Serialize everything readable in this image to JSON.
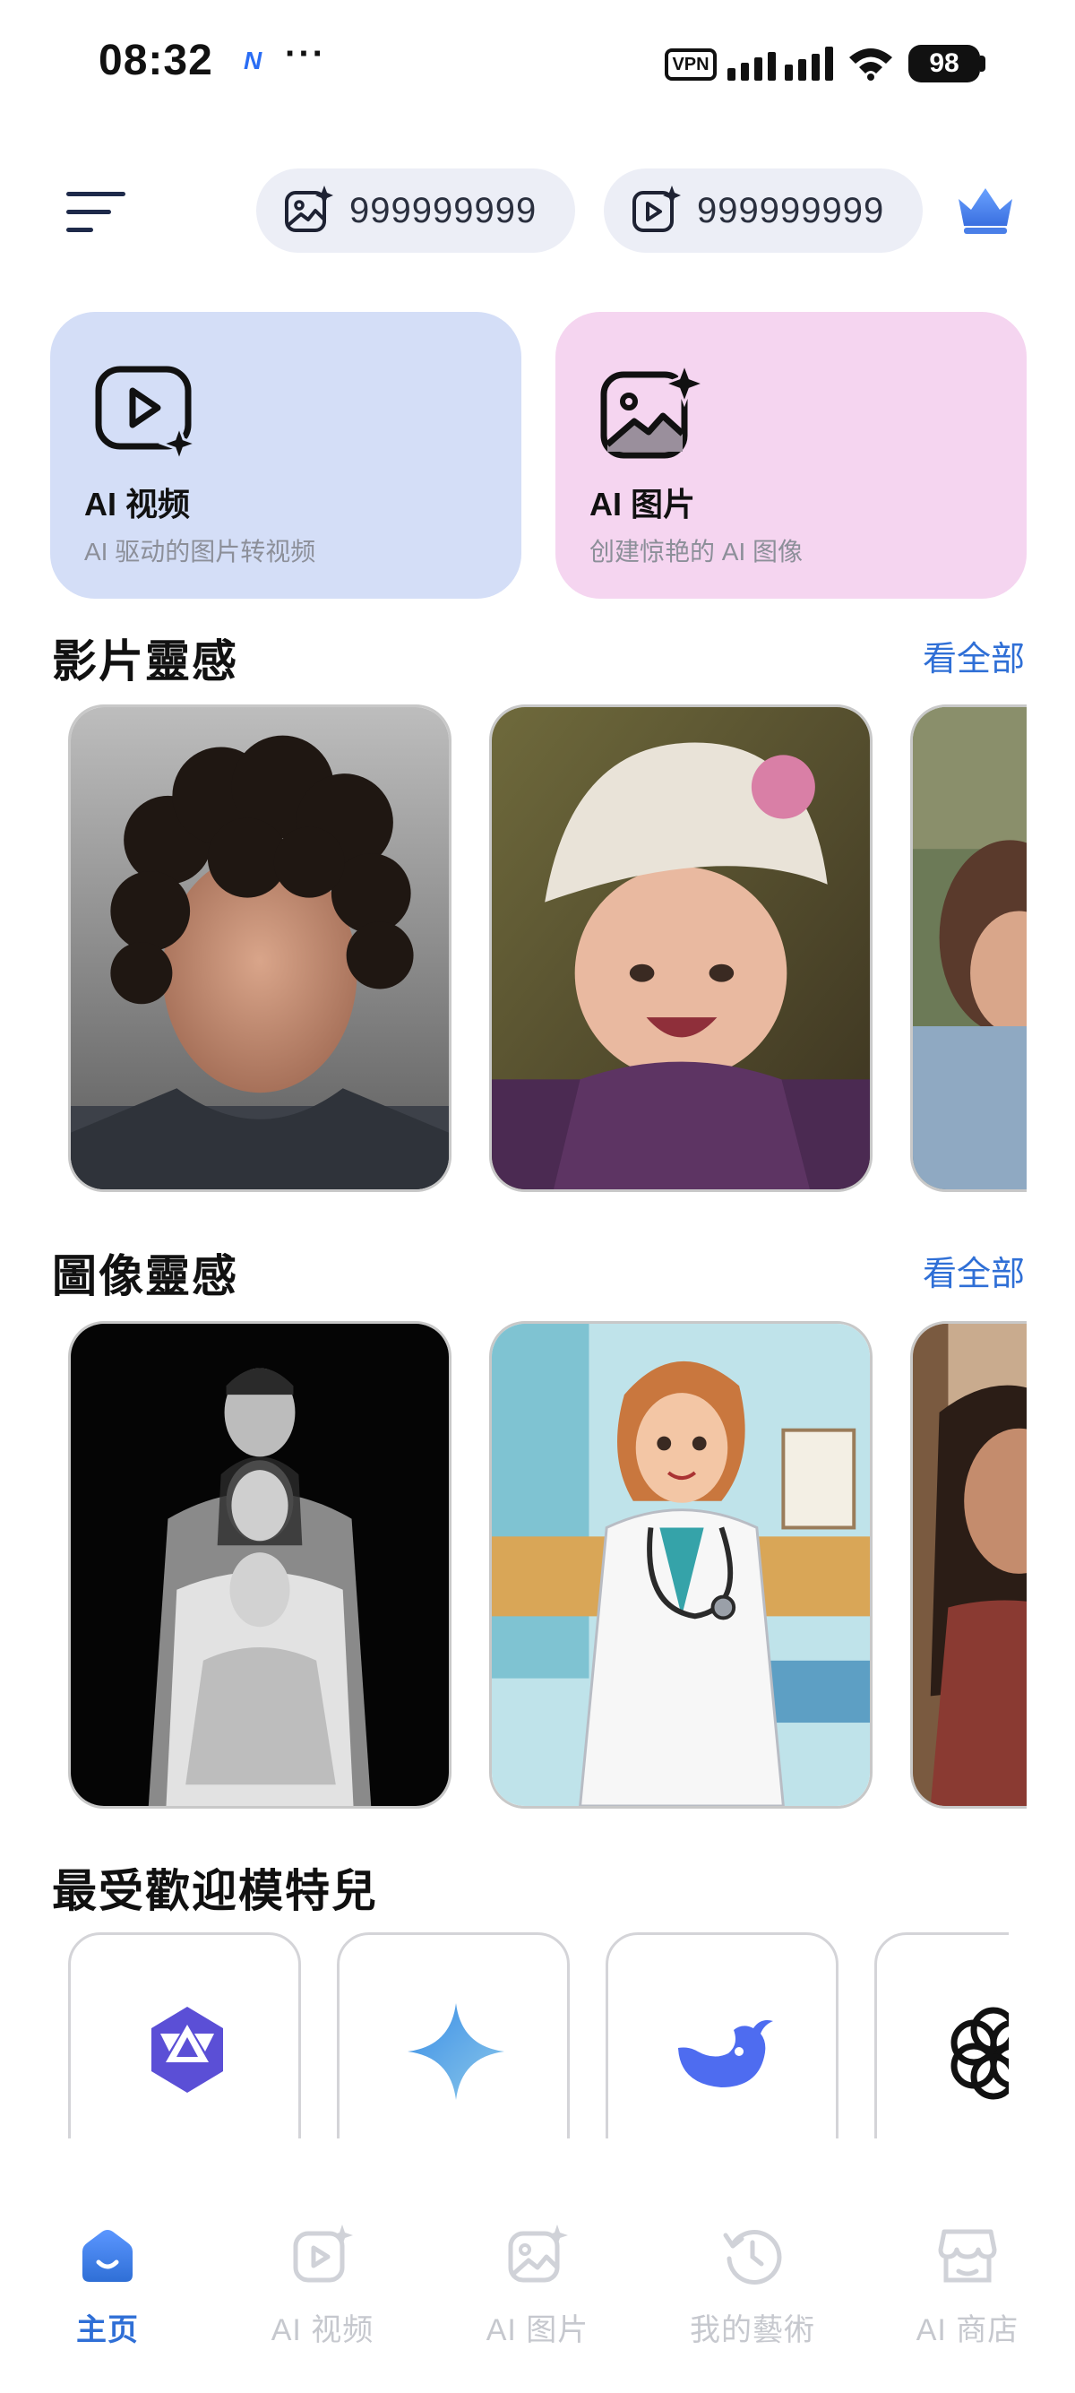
{
  "status_bar": {
    "time": "08:32",
    "app_indicator": "N",
    "more": "···",
    "vpn": "VPN",
    "battery": "98"
  },
  "header": {
    "menu_icon": "hamburger-menu-icon",
    "image_credits": "999999999",
    "video_credits": "999999999",
    "premium_icon": "crown-icon"
  },
  "features": [
    {
      "title": "AI 视频",
      "subtitle": "AI 驱动的图片转视频",
      "icon": "video-sparkle-icon",
      "color": "#d4def7"
    },
    {
      "title": "AI 图片",
      "subtitle": "创建惊艳的 AI 图像",
      "icon": "image-sparkle-icon",
      "color": "#f5d5f0"
    }
  ],
  "sections": {
    "video_inspiration": {
      "title": "影片靈感",
      "see_all": "看全部"
    },
    "image_inspiration": {
      "title": "圖像靈感",
      "see_all": "看全部"
    },
    "popular_models": {
      "title": "最受歡迎模特兒"
    }
  },
  "video_thumbs": [
    "curly-haired-man-photo",
    "smiling-toddler-knit-hat-photo",
    "hugging-people-photo"
  ],
  "image_thumbs": [
    "black-white-family-portrait",
    "cartoon-doctor-illustration",
    "woman-portrait-photo"
  ],
  "models": [
    "qwen-logo-icon",
    "gemini-sparkle-icon",
    "deepseek-whale-icon",
    "openai-logo-icon"
  ],
  "bottom_nav": [
    {
      "label": "主页",
      "icon": "home-icon",
      "active": true
    },
    {
      "label": "AI 视频",
      "icon": "video-sparkle-icon",
      "active": false
    },
    {
      "label": "AI 图片",
      "icon": "image-sparkle-icon",
      "active": false
    },
    {
      "label": "我的藝術",
      "icon": "history-clock-icon",
      "active": false
    },
    {
      "label": "AI 商店",
      "icon": "store-icon",
      "active": false
    }
  ],
  "colors": {
    "accent": "#2f6fd6",
    "nav_inactive": "#c6c8ce"
  }
}
